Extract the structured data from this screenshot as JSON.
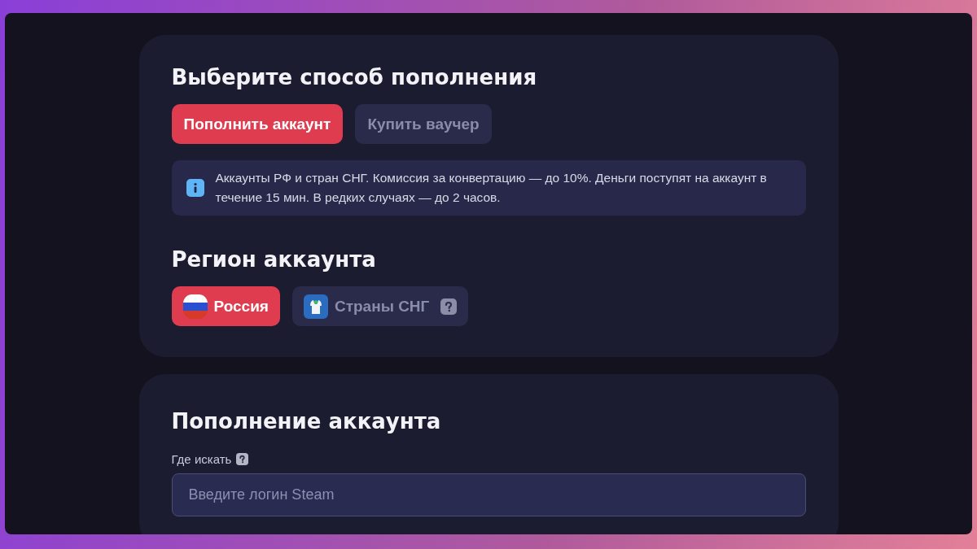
{
  "payment_method": {
    "title": "Выберите способ пополнения",
    "options": [
      {
        "label": "Пополнить аккаунт",
        "selected": true
      },
      {
        "label": "Купить ваучер",
        "selected": false
      }
    ],
    "info": "Аккаунты РФ и стран СНГ. Комиссия за конвертацию — до 10%. Деньги поступят на аккаунт в течение 15 мин. В редких случаях — до 2 часов."
  },
  "account_region": {
    "title": "Регион аккаунта",
    "options": [
      {
        "label": "Россия",
        "kind": "flag",
        "selected": true,
        "help": false
      },
      {
        "label": "Страны СНГ",
        "kind": "emblem",
        "selected": false,
        "help": true
      }
    ]
  },
  "top_up": {
    "title": "Пополнение аккаунта",
    "field_label": "Где искать",
    "field_help": true,
    "placeholder": "Введите логин Steam"
  }
}
